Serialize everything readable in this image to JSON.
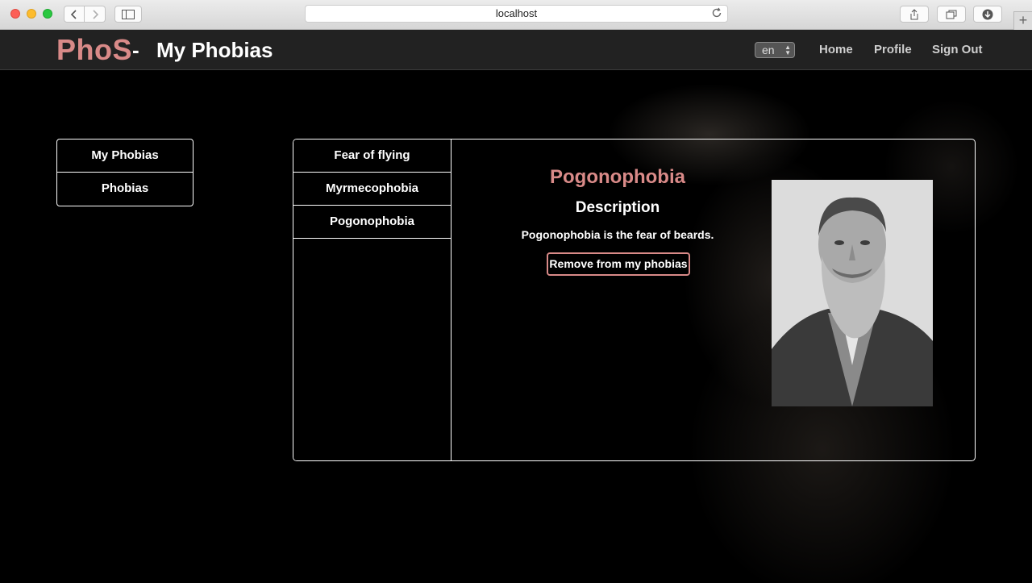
{
  "browser": {
    "url": "localhost"
  },
  "header": {
    "brand": "PhoS",
    "separator": "-",
    "title": "My Phobias",
    "language": "en",
    "nav": [
      "Home",
      "Profile",
      "Sign Out"
    ]
  },
  "left_menu": {
    "items": [
      "My Phobias",
      "Phobias"
    ]
  },
  "phobia_list": {
    "items": [
      "Fear of flying",
      "Myrmecophobia",
      "Pogonophobia"
    ]
  },
  "detail": {
    "name": "Pogonophobia",
    "heading": "Description",
    "description": "Pogonophobia is the fear of beards.",
    "remove_label": "Remove from my phobias"
  },
  "colors": {
    "accent": "#d98a88",
    "navbar": "#222222",
    "background": "#000000"
  }
}
